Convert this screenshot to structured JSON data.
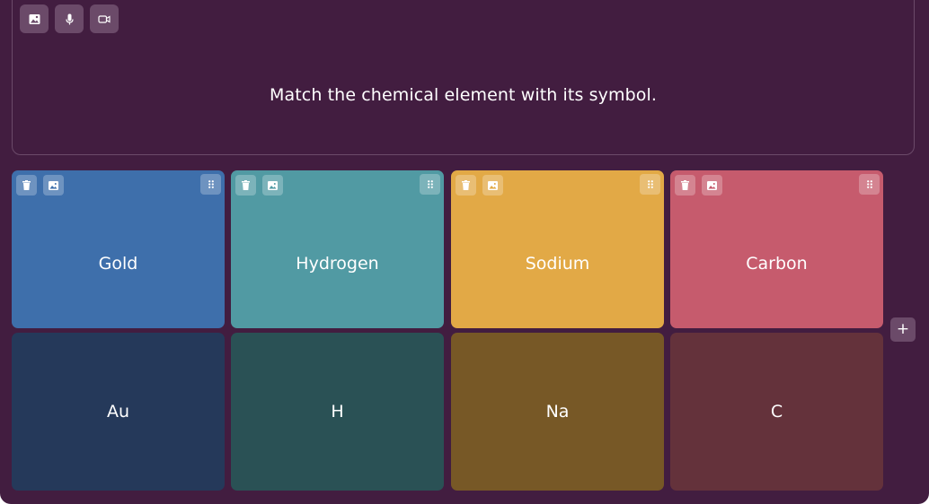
{
  "question": {
    "text": "Match the chemical element with its symbol.",
    "tools": [
      {
        "icon": "image-icon"
      },
      {
        "icon": "microphone-icon"
      },
      {
        "icon": "video-icon"
      }
    ]
  },
  "pairs": [
    {
      "term": "Gold",
      "match": "Au",
      "term_color": "#3e6fab",
      "match_color": "#25395a"
    },
    {
      "term": "Hydrogen",
      "match": "H",
      "term_color": "#519aa3",
      "match_color": "#2a5155"
    },
    {
      "term": "Sodium",
      "match": "Na",
      "term_color": "#e2a946",
      "match_color": "#775826"
    },
    {
      "term": "Carbon",
      "match": "C",
      "term_color": "#c65b6d",
      "match_color": "#64323b"
    }
  ],
  "card_tools": {
    "delete_icon": "trash-icon",
    "image_icon": "image-icon",
    "drag_icon": "drag-handle-icon"
  },
  "add_button": {
    "label": "+"
  }
}
